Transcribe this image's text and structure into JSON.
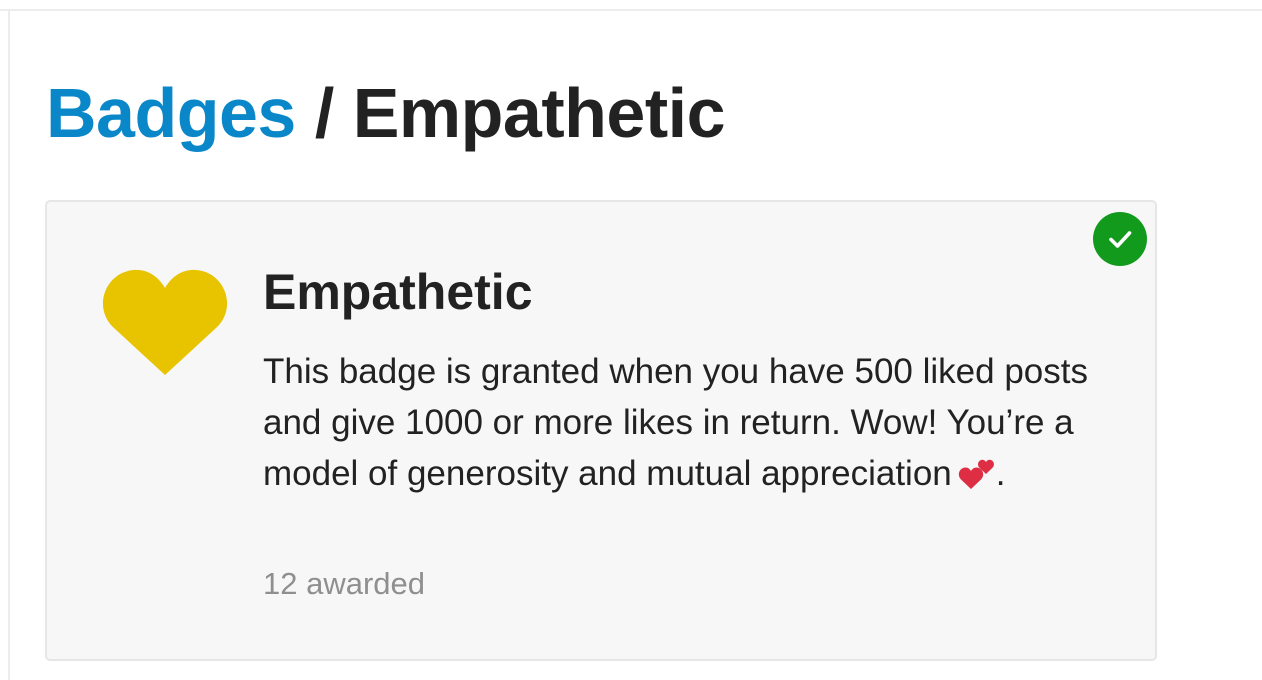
{
  "breadcrumb": {
    "parent_label": "Badges",
    "separator": "/",
    "current_label": "Empathetic"
  },
  "badge": {
    "title": "Empathetic",
    "description": "This badge is granted when you have 500 liked posts and give 1000 or more likes in return. Wow! You’re a model of generosity and mutual appreciation",
    "description_emoji": "two-hearts-icon",
    "description_end": ".",
    "awarded_text": "12 awarded",
    "icon": "heart-icon",
    "granted_indicator_icon": "check-icon"
  },
  "colors": {
    "link": "#0a87c9",
    "heart": "#e8c300",
    "granted": "#129a1c",
    "card_background": "#f7f7f7",
    "muted_text": "#8f8f8f",
    "emoji_heart": "#dd2e44"
  }
}
